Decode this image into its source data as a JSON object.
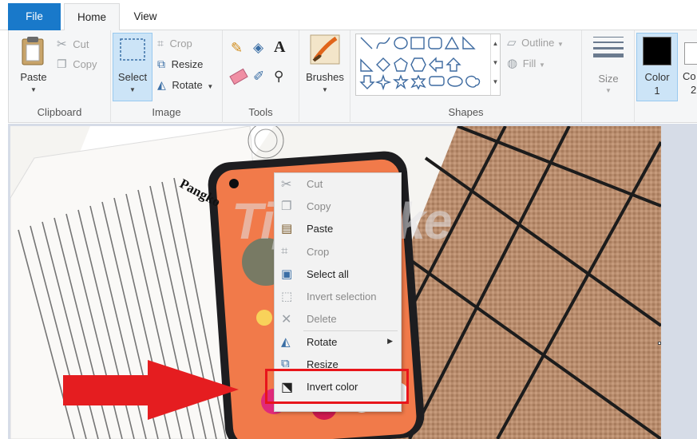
{
  "tabs": {
    "file": "File",
    "home": "Home",
    "view": "View"
  },
  "ribbon": {
    "clipboard": {
      "group": "Clipboard",
      "paste": "Paste",
      "cut": "Cut",
      "copy": "Copy"
    },
    "image": {
      "group": "Image",
      "select": "Select",
      "crop": "Crop",
      "resize": "Resize",
      "rotate": "Rotate"
    },
    "tools": {
      "group": "Tools"
    },
    "brushes": {
      "label": "Brushes"
    },
    "shapes": {
      "group": "Shapes",
      "outline": "Outline",
      "fill": "Fill"
    },
    "size": {
      "label": "Size"
    },
    "color1": {
      "label": "Color",
      "num": "1"
    },
    "color2": {
      "label": "Co",
      "num": "2"
    }
  },
  "colors": {
    "accent": "#1979ca",
    "selected_bg": "#cce4f7",
    "highlight": "#e8151b",
    "arrow": "#e51d20"
  },
  "watermark": "TipsMake",
  "book_title": "Pangko",
  "context_menu": {
    "cut": "Cut",
    "copy": "Copy",
    "paste": "Paste",
    "crop": "Crop",
    "select_all": "Select all",
    "invert_selection": "Invert selection",
    "delete": "Delete",
    "rotate": "Rotate",
    "resize": "Resize",
    "invert_color": "Invert color"
  }
}
